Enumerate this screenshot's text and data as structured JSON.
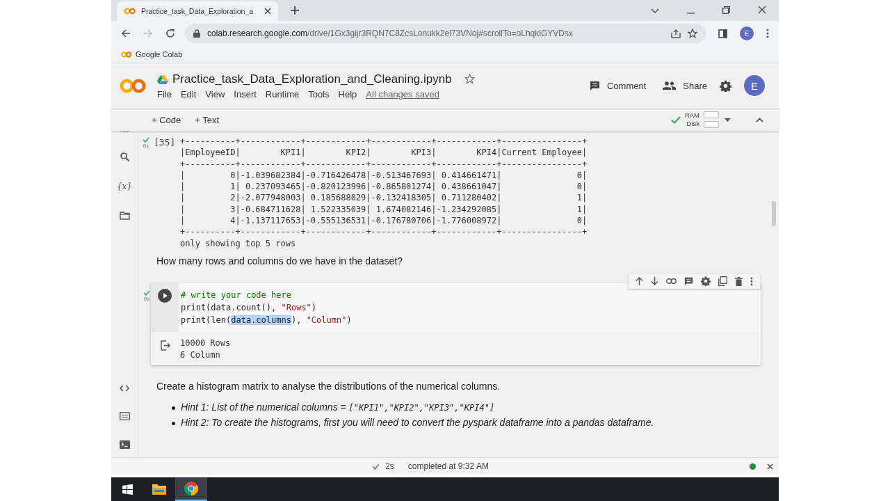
{
  "browser": {
    "tab": {
      "title": "Practice_task_Data_Exploration_a"
    },
    "url_host": "colab.research.google.com",
    "url_path": "/drive/1Gx3gijr3RQN7C8ZcsLonukk2el73VNoj#scrollTo=oLhqklGYVDsx",
    "profile_initial": "E",
    "bookmarks": [
      {
        "label": "Google Colab"
      }
    ]
  },
  "notebook": {
    "title": "Practice_task_Data_Exploration_and_Cleaning.ipynb",
    "starred": false,
    "menu": [
      "File",
      "Edit",
      "View",
      "Insert",
      "Runtime",
      "Tools",
      "Help"
    ],
    "save_status": "All changes saved",
    "actions": [
      {
        "kind": "comment",
        "label": "Comment"
      },
      {
        "kind": "share",
        "label": "Share"
      }
    ],
    "avatar": "E"
  },
  "toolbar": {
    "add_buttons": [
      "+ Code",
      "+ Text"
    ],
    "ram_label": "RAM",
    "disk_label": "Disk",
    "connected": true
  },
  "sidebar": {
    "variables_label": "{x}"
  },
  "cells": [
    {
      "kind": "output",
      "exec_count": "[35]",
      "time": "0s",
      "output_lines": [
        "+----------+------------+------------+------------+------------+----------------+",
        "|EmployeeID|        KPI1|        KPI2|        KPI3|        KPI4|Current Employee|",
        "+----------+------------+------------+------------+------------+----------------+",
        "|         0|-1.039682384|-0.716426478|-0.513467693| 0.414661471|               0|",
        "|         1| 0.237093465|-0.820123996|-0.865801274| 0.438661047|               0|",
        "|         2|-2.077948003| 0.185688029|-0.132418305| 0.711280402|               1|",
        "|         3|-0.684711628| 1.522335039| 1.674082146|-1.234292085|               1|",
        "|         4|-1.137117653|-0.555136531|-0.176780706|-1.776008972|               0|",
        "+----------+------------+------------+------------+------------+----------------+",
        "only showing top 5 rows"
      ]
    },
    {
      "kind": "markdown",
      "text": "How many rows and columns do we have in the dataset?"
    },
    {
      "kind": "code",
      "time": "0s",
      "lines": [
        [
          {
            "kind": "comment",
            "text": "# write your code here"
          }
        ],
        [
          {
            "kind": "plain",
            "text": "print(data.count(), "
          },
          {
            "kind": "string",
            "text": "\"Rows\""
          },
          {
            "kind": "plain",
            "text": ")"
          }
        ],
        [
          {
            "kind": "plain",
            "text": "print(len("
          },
          {
            "kind": "selection",
            "text": "data.columns"
          },
          {
            "kind": "plain",
            "text": "), "
          },
          {
            "kind": "string",
            "text": "\"Column\""
          },
          {
            "kind": "plain",
            "text": ")"
          }
        ]
      ],
      "output_lines": [
        "10000 Rows",
        "6 Column"
      ]
    },
    {
      "kind": "markdown",
      "text": "Create a histogram matrix to analyse the distributions of the numerical columns.",
      "bullets": [
        {
          "text": "Hint 1: List of the numerical columns = ",
          "code": "[\"KPI1\",\"KPI2\",\"KPI3\",\"KPI4\"]"
        },
        {
          "text": "Hint 2: To create the histograms, first you will need to convert the pyspark dataframe into a pandas dataframe."
        }
      ]
    }
  ],
  "status_bar": {
    "duration": "2s",
    "message": "completed at 9:32 AM",
    "connected": true
  },
  "taskbar": [
    {
      "kind": "start",
      "selected": false
    },
    {
      "kind": "files",
      "selected": false
    },
    {
      "kind": "chrome",
      "selected": true
    }
  ]
}
